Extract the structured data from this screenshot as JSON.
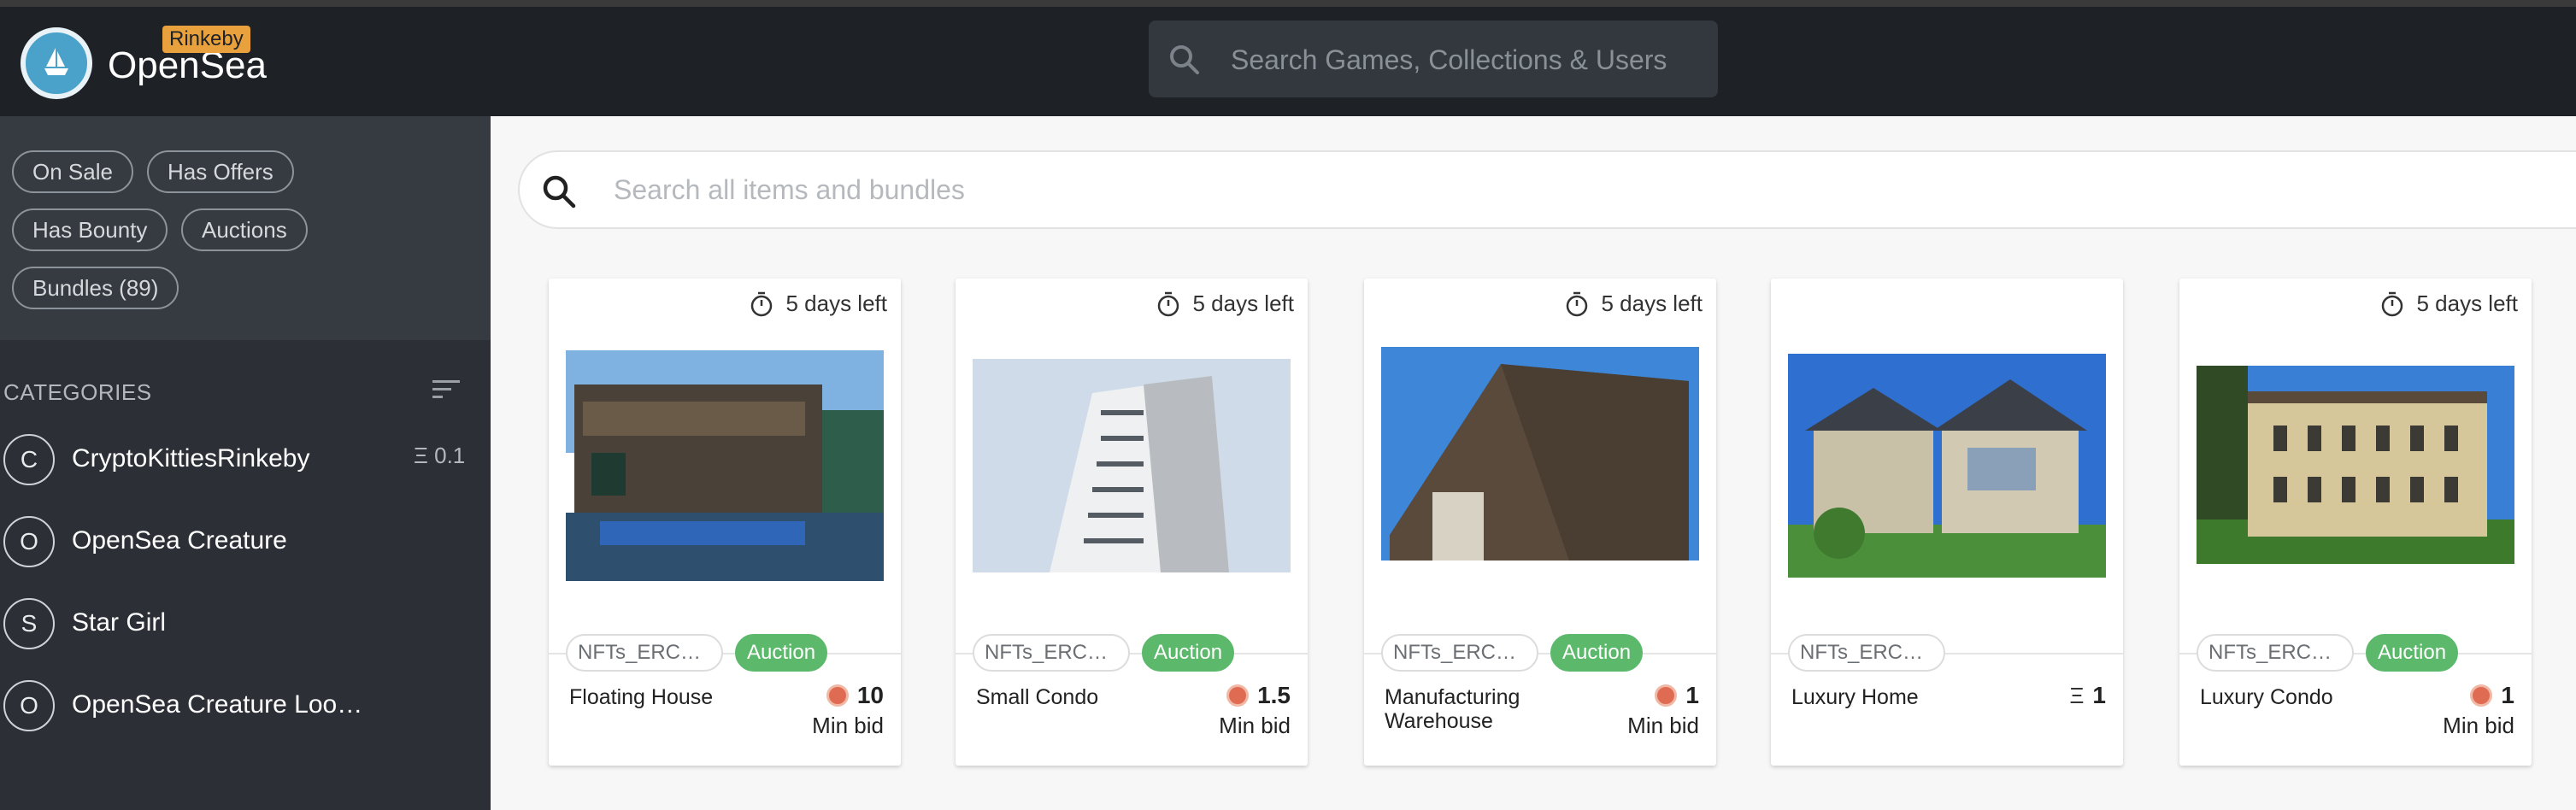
{
  "header": {
    "brand": "OpenSea",
    "network_badge": "Rinkeby",
    "search_placeholder": "Search Games, Collections & Users"
  },
  "filters": [
    "On Sale",
    "Has Offers",
    "Has Bounty",
    "Auctions",
    "Bundles (89)"
  ],
  "categories": {
    "title": "CATEGORIES",
    "items": [
      {
        "initial": "C",
        "label": "CryptoKittiesRinkeby",
        "price": "Ξ 0.1"
      },
      {
        "initial": "O",
        "label": "OpenSea Creature",
        "price": ""
      },
      {
        "initial": "S",
        "label": "Star Girl",
        "price": ""
      },
      {
        "initial": "O",
        "label": "OpenSea Creature Loo…",
        "price": ""
      }
    ]
  },
  "main": {
    "search_placeholder": "Search all items and bundles"
  },
  "cards": [
    {
      "timer": "5 days left",
      "collection": "NFTs_ERC7…",
      "badge": "Auction",
      "name": "Floating House",
      "price": "10",
      "currency": "weth",
      "min_bid": "Min bid"
    },
    {
      "timer": "5 days left",
      "collection": "NFTs_ERC7…",
      "badge": "Auction",
      "name": "Small Condo",
      "price": "1.5",
      "currency": "weth",
      "min_bid": "Min bid"
    },
    {
      "timer": "5 days left",
      "collection": "NFTs_ERC7…",
      "badge": "Auction",
      "name": "Manufacturing Warehouse",
      "price": "1",
      "currency": "weth",
      "min_bid": "Min bid"
    },
    {
      "timer": "",
      "collection": "NFTs_ERC7…",
      "badge": "",
      "name": "Luxury Home",
      "price": "1",
      "currency": "eth",
      "min_bid": ""
    },
    {
      "timer": "5 days left",
      "collection": "NFTs_ERC7…",
      "badge": "Auction",
      "name": "Luxury Condo",
      "price": "1",
      "currency": "weth",
      "min_bid": "Min bid"
    }
  ],
  "colors": {
    "topbar": "#1e2227",
    "sidebar": "#2c3036",
    "auction_green": "#5cb86a",
    "brand_blue": "#4aa1c9"
  }
}
